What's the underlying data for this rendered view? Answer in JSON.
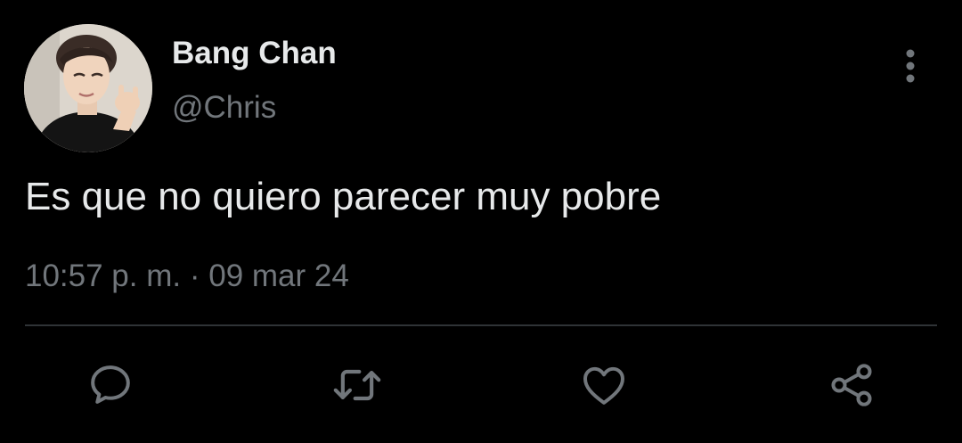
{
  "tweet": {
    "author": {
      "display_name": "Bang Chan",
      "handle": "@Chris",
      "avatar_icon": "profile-photo"
    },
    "text": "Es que no quiero parecer muy pobre",
    "time": "10:57 p. m.",
    "separator": "·",
    "date": "09 mar 24",
    "timestamp": "10:57 p. m. · 09 mar 24"
  },
  "actions": [
    {
      "name": "reply",
      "icon": "speech-bubble-icon"
    },
    {
      "name": "retweet",
      "icon": "retweet-icon"
    },
    {
      "name": "like",
      "icon": "heart-icon"
    },
    {
      "name": "share",
      "icon": "share-icon"
    }
  ],
  "more_menu_icon": "vertical-ellipsis-icon",
  "colors": {
    "background": "#000000",
    "primary_text": "#e7e9ea",
    "secondary_text": "#71767b",
    "divider": "#2f3336",
    "icon": "#71767b"
  }
}
